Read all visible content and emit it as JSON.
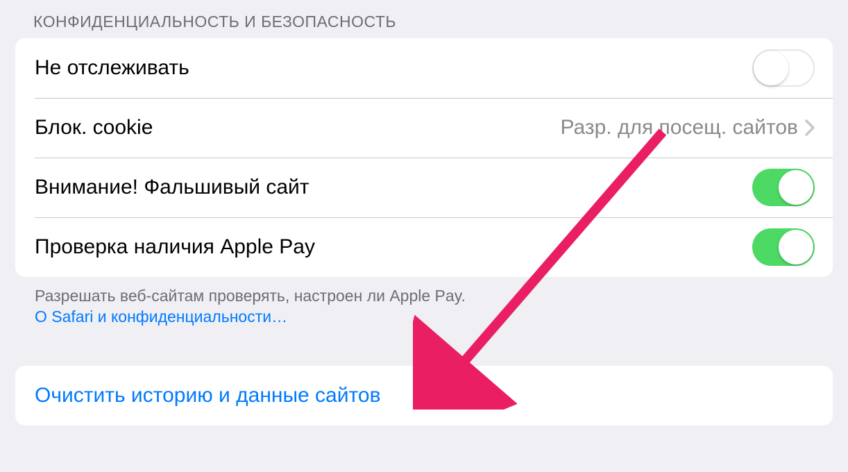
{
  "section": {
    "header": "КОНФИДЕНЦИАЛЬНОСТЬ И БЕЗОПАСНОСТЬ"
  },
  "rows": {
    "no_tracking": {
      "label": "Не отслеживать",
      "toggle_on": false
    },
    "block_cookie": {
      "label": "Блок. cookie",
      "value": "Разр. для посещ. сайтов"
    },
    "fraud_warning": {
      "label": "Внимание! Фальшивый сайт",
      "toggle_on": true
    },
    "apple_pay_check": {
      "label": "Проверка наличия Apple Pay",
      "toggle_on": true
    }
  },
  "footer": {
    "text": "Разрешать веб-сайтам проверять, настроен ли Apple Pay.",
    "link": "О Safari и конфиденциальности…"
  },
  "action": {
    "clear_history": "Очистить историю и данные сайтов"
  }
}
